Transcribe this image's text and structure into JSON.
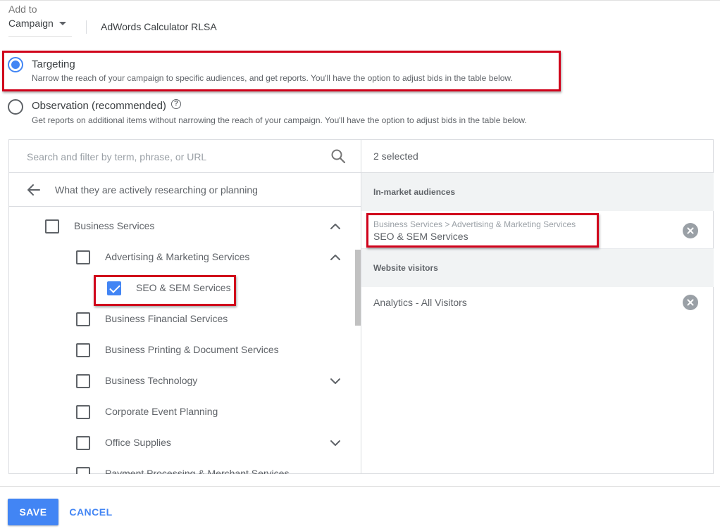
{
  "add_to": {
    "label": "Add to",
    "selected": "Campaign",
    "campaign_name": "AdWords Calculator RLSA"
  },
  "targeting_options": [
    {
      "title": "Targeting",
      "description": "Narrow the reach of your campaign to specific audiences, and get reports. You'll have the option to adjust bids in the table below.",
      "selected": true
    },
    {
      "title": "Observation (recommended)",
      "description": "Get reports on additional items without narrowing the reach of your campaign. You'll have the option to adjust bids in the table below.",
      "selected": false,
      "help_icon": "?"
    }
  ],
  "browse": {
    "search_placeholder": "Search and filter by term, phrase, or URL",
    "back_label": "What they are actively researching or planning",
    "tree": [
      {
        "label": "Business Services",
        "checked": false,
        "expanded": true,
        "chevron": "up"
      },
      {
        "label": "Advertising & Marketing Services",
        "checked": false,
        "expanded": true,
        "chevron": "up"
      },
      {
        "label": "SEO & SEM Services",
        "checked": true
      },
      {
        "label": "Business Financial Services",
        "checked": false
      },
      {
        "label": "Business Printing & Document Services",
        "checked": false
      },
      {
        "label": "Business Technology",
        "checked": false,
        "chevron": "down"
      },
      {
        "label": "Corporate Event Planning",
        "checked": false
      },
      {
        "label": "Office Supplies",
        "checked": false,
        "chevron": "down"
      },
      {
        "label": "Payment Processing & Merchant Services",
        "checked": false
      }
    ]
  },
  "selected_panel": {
    "count_text": "2 selected",
    "groups": [
      {
        "heading": "In-market audiences",
        "items": [
          {
            "path": "Business Services > Advertising & Marketing Services",
            "name": "SEO & SEM Services"
          }
        ]
      },
      {
        "heading": "Website visitors",
        "items": [
          {
            "path": "",
            "name": "Analytics - All Visitors"
          }
        ]
      }
    ]
  },
  "footer": {
    "save_label": "SAVE",
    "cancel_label": "CANCEL"
  },
  "colors": {
    "accent": "#4285f4",
    "highlight_box": "#d0021b",
    "panel_section_bg": "#f1f3f4"
  }
}
